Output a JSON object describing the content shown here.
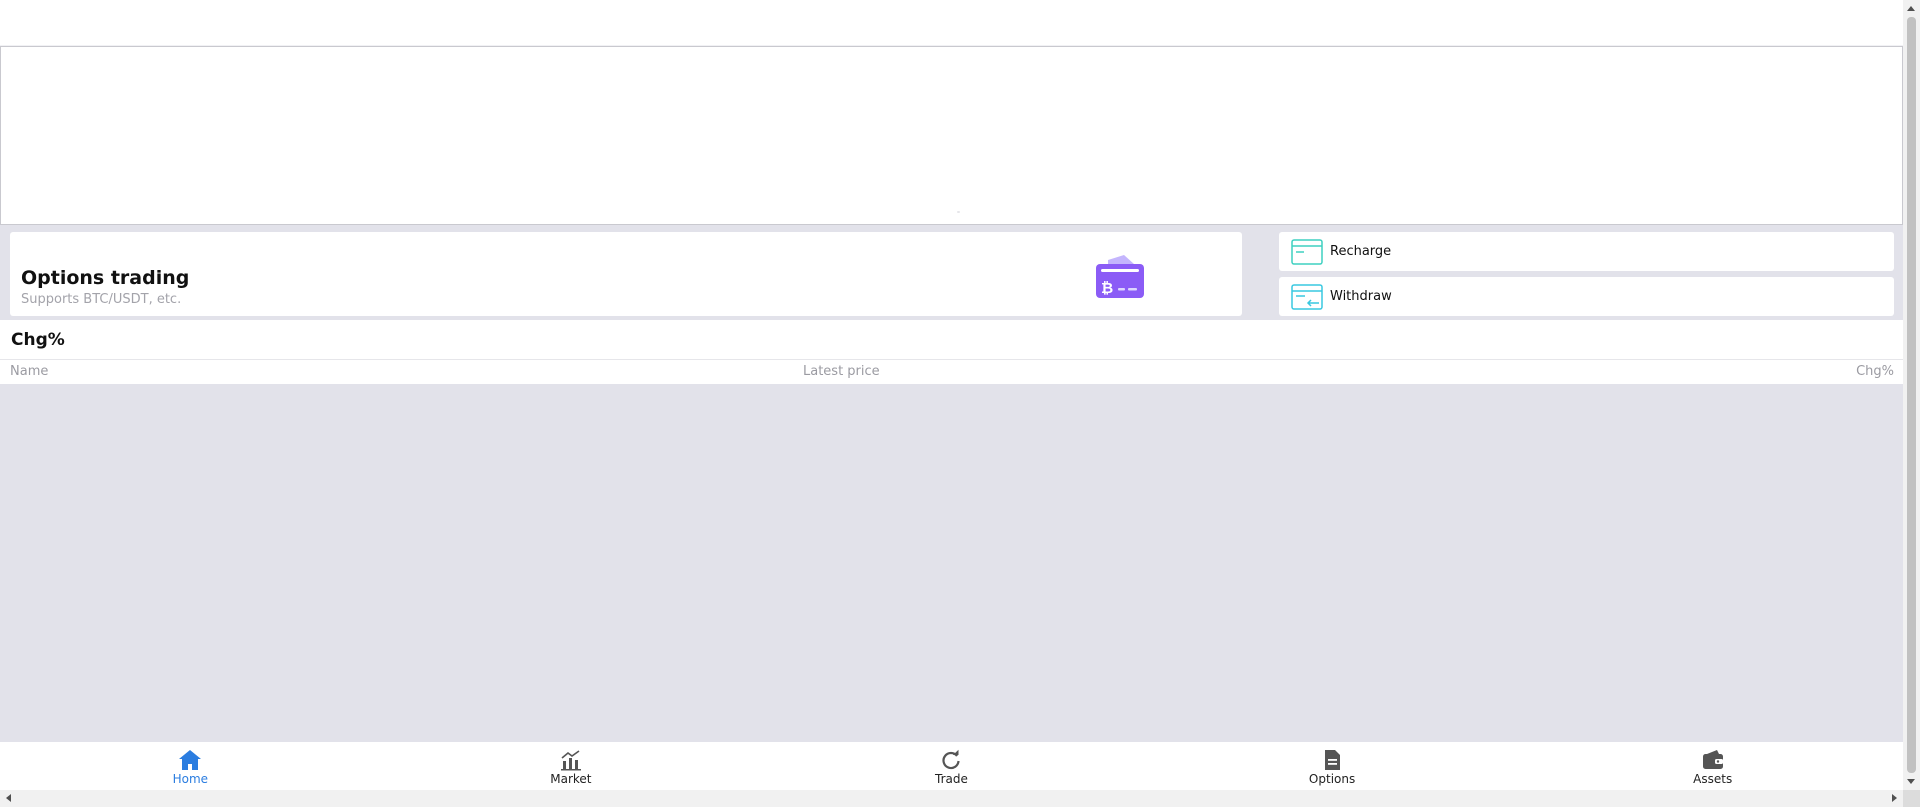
{
  "options_card": {
    "title": "Options trading",
    "subtitle": "Supports BTC/USDT, etc.",
    "illustration_icon": "bitcoin-card-icon",
    "accent_color": "#8b5cf6"
  },
  "actions": {
    "recharge": {
      "label": "Recharge",
      "icon": "recharge-card-icon",
      "color": "#3fd0c0"
    },
    "withdraw": {
      "label": "Withdraw",
      "icon": "withdraw-card-icon",
      "color": "#39c8e0"
    }
  },
  "section": {
    "title": "Chg%"
  },
  "list_header": {
    "name": "Name",
    "price": "Latest price",
    "change": "Chg%"
  },
  "tabbar": {
    "active": "Home",
    "active_color": "#2b7de0",
    "items": [
      {
        "label": "Home",
        "icon": "home-icon"
      },
      {
        "label": "Market",
        "icon": "market-chart-icon"
      },
      {
        "label": "Trade",
        "icon": "refresh-icon"
      },
      {
        "label": "Options",
        "icon": "document-icon"
      },
      {
        "label": "Assets",
        "icon": "wallet-icon"
      }
    ]
  }
}
